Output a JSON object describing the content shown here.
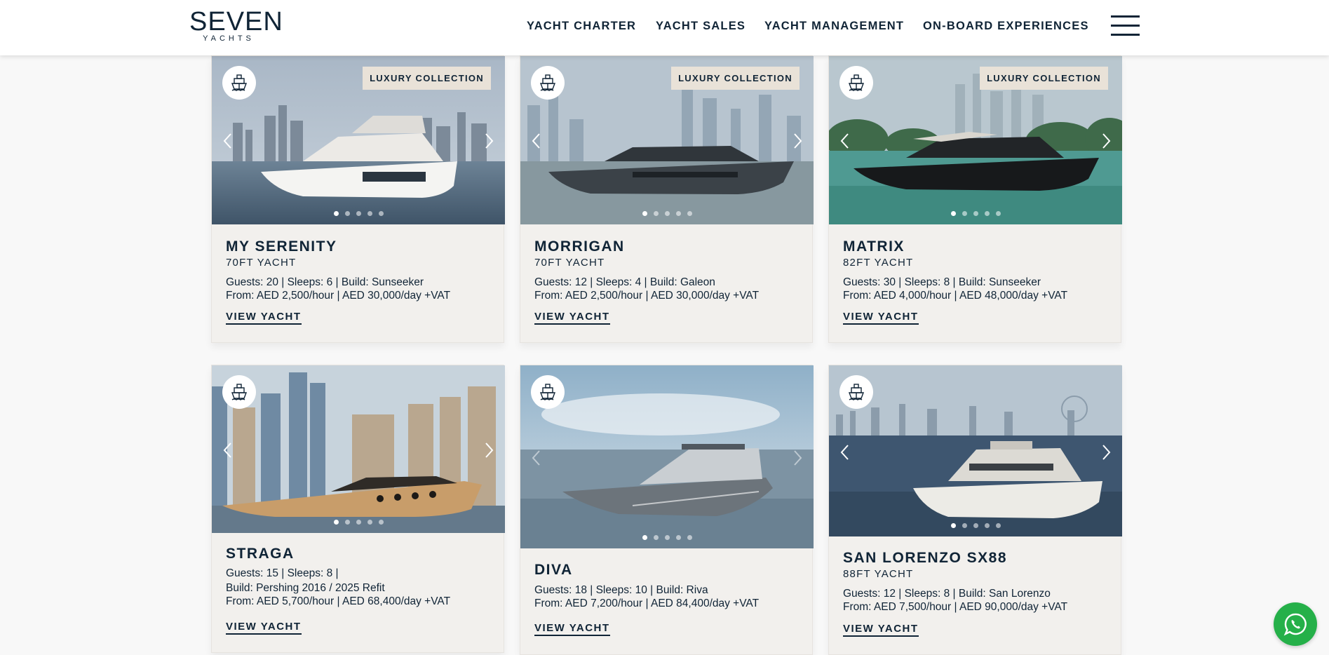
{
  "header": {
    "logo_main": "SEVEN",
    "logo_sub": "YACHTS",
    "nav": [
      {
        "label": "YACHT CHARTER"
      },
      {
        "label": "YACHT SALES"
      },
      {
        "label": "YACHT MANAGEMENT"
      },
      {
        "label": "ON-BOARD EXPERIENCES"
      }
    ],
    "menu_icon": "hamburger-menu-icon"
  },
  "cards": [
    {
      "name": "MY SERENITY",
      "size": "70FT YACHT",
      "specs": "Guests: 20  |  Sleeps: 6  |  Build: Sunseeker",
      "price": "From: AED 2,500/hour | AED 30,000/day +VAT",
      "badge": "LUXURY COLLECTION",
      "cta": "VIEW YACHT",
      "slide_count": 5,
      "active_slide": 1,
      "hull_color": "#f4f4f2"
    },
    {
      "name": "MORRIGAN",
      "size": "70FT YACHT",
      "specs": "Guests: 12  |  Sleeps: 4  |  Build: Galeon",
      "price": "From: AED 2,500/hour | AED 30,000/day +VAT",
      "badge": "LUXURY COLLECTION",
      "cta": "VIEW YACHT",
      "slide_count": 5,
      "active_slide": 1,
      "hull_color": "#3b4248"
    },
    {
      "name": "MATRIX",
      "size": "82FT YACHT",
      "specs": "Guests: 30  |  Sleeps: 8  |  Build: Sunseeker",
      "price": "From: AED 4,000/hour | AED 48,000/day +VAT",
      "badge": "LUXURY COLLECTION",
      "cta": "VIEW YACHT",
      "slide_count": 5,
      "active_slide": 1,
      "hull_color": "#17191b"
    },
    {
      "name": "STRAGA",
      "specs": "Guests: 15  |  Sleeps: 8  |",
      "specs2": "Build: Pershing 2016 / 2025 Refit",
      "price": "From: AED 5,700/hour | AED 68,400/day +VAT",
      "cta": "VIEW YACHT",
      "slide_count": 5,
      "active_slide": 1,
      "hull_color": "#c89d6a"
    },
    {
      "name": "DIVA",
      "specs": "Guests: 18  |  Sleeps: 10  |  Build: Riva",
      "price": "From: AED 7,200/hour | AED 84,400/day +VAT",
      "cta": "VIEW YACHT",
      "slide_count": 5,
      "active_slide": 1,
      "hull_color": "#6c747b"
    },
    {
      "name": "SAN LORENZO SX88",
      "size": "88FT YACHT",
      "specs": "Guests: 12  |  Sleeps: 8  |  Build: San Lorenzo",
      "price": "From: AED 7,500/hour | AED 90,000/day +VAT",
      "cta": "VIEW YACHT",
      "slide_count": 5,
      "active_slide": 1,
      "hull_color": "#ecebe6"
    }
  ],
  "whatsapp_icon": "whatsapp-icon"
}
